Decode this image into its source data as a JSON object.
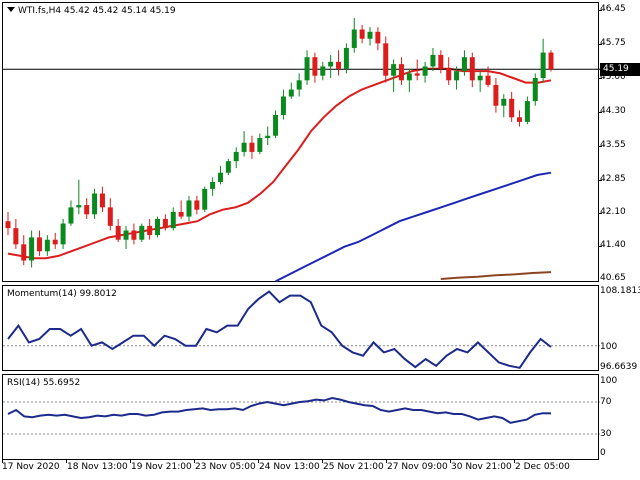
{
  "main": {
    "title": "WTI.fs,H4  45.42 45.42 45.14 45.19",
    "current_price": "45.19",
    "y_labels": [
      "46.45",
      "45.75",
      "45.00",
      "44.30",
      "43.55",
      "42.85",
      "42.10",
      "41.40",
      "40.65"
    ],
    "colors": {
      "bull": "#0a8a1e",
      "bear": "#dd1c1c",
      "ema_fast": "#dd1c1c",
      "ema_mid": "#1c28b4",
      "ema_slow": "#8c4423",
      "price_line": "#000000"
    }
  },
  "momentum": {
    "title": "Momentum(14) 99.8012",
    "y_labels": [
      "108.1813",
      "100",
      "96.6639"
    ],
    "color": "#1c2a8c"
  },
  "rsi": {
    "title": "RSI(14) 55.6952",
    "y_labels": [
      "100",
      "70",
      "30",
      "0"
    ],
    "color": "#1c2a8c"
  },
  "x_axis": {
    "labels": [
      "17 Nov 2020",
      "18 Nov 13:00",
      "19 Nov 21:00",
      "23 Nov 05:00",
      "24 Nov 13:00",
      "25 Nov 21:00",
      "27 Nov 09:00",
      "30 Nov 21:00",
      "2 Dec 05:00"
    ]
  },
  "chart_data": {
    "type": "candlestick",
    "symbol": "WTI.fs",
    "timeframe": "H4",
    "candles": [
      [
        41.9,
        42.1,
        41.6,
        41.75
      ],
      [
        41.75,
        41.95,
        41.3,
        41.4
      ],
      [
        41.4,
        41.6,
        40.95,
        41.05
      ],
      [
        41.05,
        41.7,
        40.9,
        41.55
      ],
      [
        41.55,
        41.7,
        41.15,
        41.25
      ],
      [
        41.25,
        41.6,
        41.15,
        41.5
      ],
      [
        41.5,
        41.65,
        41.3,
        41.4
      ],
      [
        41.4,
        41.95,
        41.3,
        41.85
      ],
      [
        41.85,
        42.35,
        41.8,
        42.2
      ],
      [
        42.2,
        42.8,
        42.05,
        42.25
      ],
      [
        42.25,
        42.4,
        41.95,
        42.05
      ],
      [
        42.05,
        42.6,
        41.95,
        42.5
      ],
      [
        42.5,
        42.65,
        42.1,
        42.2
      ],
      [
        42.2,
        42.4,
        41.7,
        41.8
      ],
      [
        41.8,
        41.95,
        41.45,
        41.5
      ],
      [
        41.5,
        41.8,
        41.3,
        41.7
      ],
      [
        41.7,
        41.85,
        41.4,
        41.5
      ],
      [
        41.5,
        41.85,
        41.45,
        41.8
      ],
      [
        41.8,
        41.95,
        41.5,
        41.6
      ],
      [
        41.6,
        42.0,
        41.55,
        41.95
      ],
      [
        41.95,
        42.05,
        41.7,
        41.75
      ],
      [
        41.75,
        42.2,
        41.7,
        42.1
      ],
      [
        42.1,
        42.35,
        41.95,
        42.0
      ],
      [
        42.0,
        42.45,
        41.9,
        42.35
      ],
      [
        42.35,
        42.45,
        42.05,
        42.15
      ],
      [
        42.15,
        42.65,
        42.1,
        42.6
      ],
      [
        42.6,
        42.85,
        42.45,
        42.75
      ],
      [
        42.75,
        43.1,
        42.7,
        42.95
      ],
      [
        42.95,
        43.25,
        42.9,
        43.2
      ],
      [
        43.2,
        43.5,
        43.05,
        43.4
      ],
      [
        43.4,
        43.85,
        43.3,
        43.6
      ],
      [
        43.6,
        43.75,
        43.25,
        43.4
      ],
      [
        43.4,
        43.8,
        43.35,
        43.7
      ],
      [
        43.7,
        43.95,
        43.55,
        43.75
      ],
      [
        43.75,
        44.3,
        43.7,
        44.2
      ],
      [
        44.2,
        44.75,
        44.1,
        44.6
      ],
      [
        44.6,
        44.9,
        44.55,
        44.75
      ],
      [
        44.75,
        45.1,
        44.6,
        44.95
      ],
      [
        44.95,
        45.6,
        44.85,
        45.45
      ],
      [
        45.45,
        45.55,
        44.9,
        45.05
      ],
      [
        45.05,
        45.35,
        44.95,
        45.25
      ],
      [
        45.25,
        45.5,
        45.0,
        45.35
      ],
      [
        45.35,
        45.6,
        45.05,
        45.2
      ],
      [
        45.2,
        45.75,
        45.1,
        45.65
      ],
      [
        45.65,
        46.3,
        45.55,
        46.05
      ],
      [
        46.05,
        46.15,
        45.75,
        45.85
      ],
      [
        45.85,
        46.1,
        45.7,
        46.0
      ],
      [
        46.0,
        46.1,
        45.6,
        45.75
      ],
      [
        45.75,
        45.9,
        44.9,
        45.05
      ],
      [
        45.05,
        45.4,
        44.7,
        45.3
      ],
      [
        45.3,
        45.45,
        44.85,
        44.95
      ],
      [
        44.95,
        45.2,
        44.7,
        45.1
      ],
      [
        45.1,
        45.4,
        44.95,
        45.05
      ],
      [
        45.05,
        45.35,
        44.9,
        45.25
      ],
      [
        45.25,
        45.65,
        45.15,
        45.5
      ],
      [
        45.5,
        45.6,
        45.1,
        45.2
      ],
      [
        45.2,
        45.45,
        44.85,
        44.95
      ],
      [
        44.95,
        45.25,
        44.75,
        45.15
      ],
      [
        45.15,
        45.6,
        45.05,
        45.45
      ],
      [
        45.45,
        45.55,
        44.8,
        44.95
      ],
      [
        44.95,
        45.15,
        44.7,
        45.05
      ],
      [
        45.05,
        45.25,
        44.8,
        44.85
      ],
      [
        44.85,
        45.0,
        44.25,
        44.4
      ],
      [
        44.4,
        44.65,
        44.15,
        44.55
      ],
      [
        44.55,
        44.7,
        44.05,
        44.15
      ],
      [
        44.15,
        44.3,
        43.95,
        44.05
      ],
      [
        44.05,
        44.6,
        44.0,
        44.5
      ],
      [
        44.5,
        45.1,
        44.4,
        45.0
      ],
      [
        45.0,
        45.85,
        44.9,
        45.55
      ],
      [
        45.55,
        45.6,
        45.14,
        45.19
      ]
    ],
    "ema_fast": [
      41.2,
      41.15,
      41.1,
      41.1,
      41.15,
      41.25,
      41.35,
      41.45,
      41.55,
      41.6,
      41.65,
      41.7,
      41.75,
      41.8,
      41.85,
      41.9,
      42.05,
      42.15,
      42.2,
      42.3,
      42.5,
      42.75,
      43.1,
      43.45,
      43.85,
      44.15,
      44.4,
      44.6,
      44.75,
      44.85,
      44.95,
      45.05,
      45.15,
      45.2,
      45.2,
      45.2,
      45.15,
      45.15,
      45.15,
      45.1,
      45.0,
      44.9,
      44.9,
      44.95
    ],
    "ema_mid": [
      40.6,
      40.75,
      40.9,
      41.05,
      41.2,
      41.35,
      41.45,
      41.6,
      41.75,
      41.9,
      42.0,
      42.1,
      42.2,
      42.3,
      42.4,
      42.5,
      42.6,
      42.7,
      42.8,
      42.9,
      42.95
    ],
    "ema_slow": [
      40.65,
      40.68,
      40.7,
      40.73,
      40.75,
      40.78,
      40.8
    ],
    "momentum": [
      101.0,
      103.0,
      100.5,
      101.0,
      102.5,
      102.5,
      101.5,
      102.5,
      100.0,
      100.5,
      99.5,
      100.5,
      101.5,
      101.5,
      100.0,
      101.5,
      101.0,
      100.0,
      100.0,
      102.5,
      102.0,
      103.0,
      103.0,
      105.5,
      107.0,
      108.1,
      106.5,
      107.5,
      107.5,
      106.5,
      103.0,
      102.0,
      100.0,
      99.0,
      98.5,
      100.5,
      99.0,
      99.5,
      98.0,
      96.8,
      98.0,
      97.0,
      98.5,
      99.5,
      99.0,
      100.5,
      99.0,
      97.5,
      97.0,
      96.7,
      99.0,
      101.0,
      99.8
    ],
    "rsi": [
      55,
      60,
      52,
      51,
      53,
      54,
      53,
      54,
      52,
      50,
      51,
      53,
      52,
      54,
      53,
      55,
      55,
      53,
      54,
      57,
      58,
      58,
      60,
      61,
      62,
      60,
      61,
      61,
      62,
      60,
      65,
      68,
      70,
      68,
      66,
      68,
      70,
      71,
      73,
      72,
      75,
      73,
      70,
      68,
      66,
      65,
      60,
      58,
      60,
      62,
      60,
      60,
      58,
      56,
      57,
      55,
      55,
      52,
      48,
      50,
      52,
      50,
      44,
      46,
      48,
      54,
      56,
      55.7
    ],
    "xlabel": "",
    "ylabel": ""
  }
}
